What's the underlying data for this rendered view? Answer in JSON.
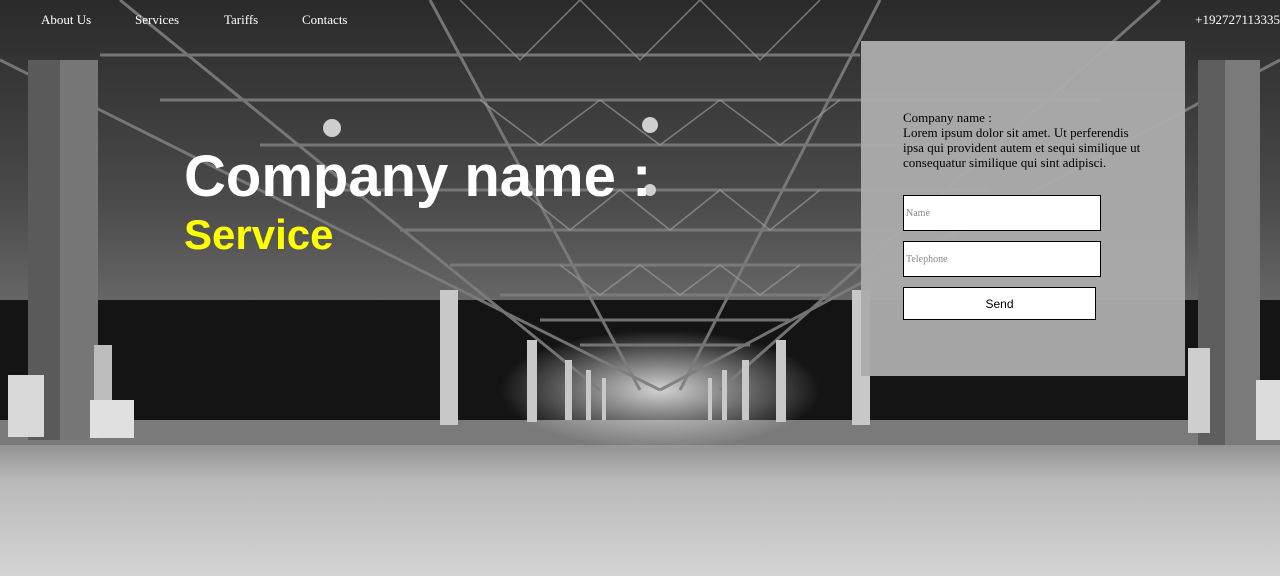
{
  "nav": {
    "items": [
      {
        "label": "About Us"
      },
      {
        "label": "Services"
      },
      {
        "label": "Tariffs"
      },
      {
        "label": "Contacts"
      }
    ],
    "phone": "+192727113335"
  },
  "hero": {
    "title": "Company name :",
    "subtitle": "Service",
    "background": "warehouse-interior-image"
  },
  "contact": {
    "heading": "Company name :",
    "description": "Lorem ipsum dolor sit amet. Ut perferendis ipsa qui provident autem et sequi similique ut consequatur similique qui sint adipisci.",
    "name_placeholder": "Name",
    "telephone_placeholder": "Telephone",
    "send_label": "Send"
  },
  "colors": {
    "subtitle": "#ffff00",
    "title": "#ffffff",
    "panel": "#aaaaaa"
  }
}
